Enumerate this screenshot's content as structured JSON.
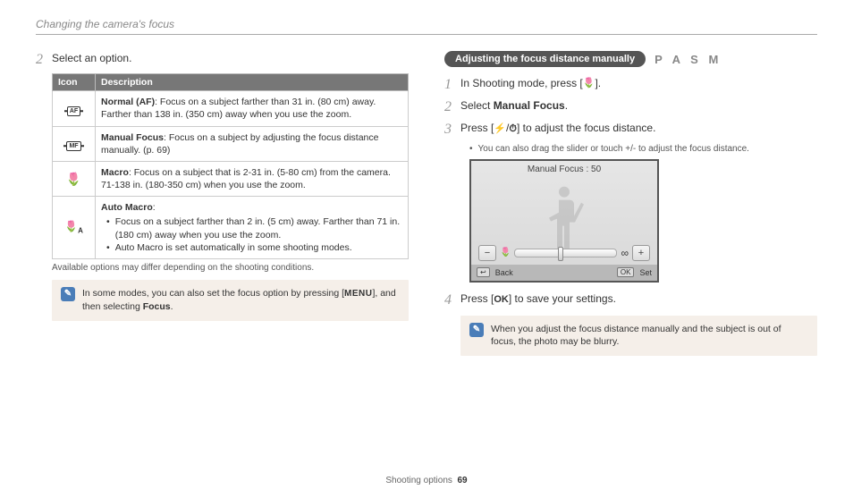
{
  "header": "Changing the camera's focus",
  "left": {
    "step2_num": "2",
    "step2_text": "Select an option.",
    "table": {
      "th_icon": "Icon",
      "th_desc": "Description",
      "rows": [
        {
          "icon_label": "AF",
          "icon_name": "normal-af-icon",
          "strong": "Normal (AF)",
          "rest": ": Focus on a subject farther than 31 in. (80 cm) away. Farther than 138 in. (350 cm) away when you use the zoom."
        },
        {
          "icon_label": "MF",
          "icon_name": "manual-focus-icon",
          "strong": "Manual Focus",
          "rest": ": Focus on a subject by adjusting the focus distance manually. (p. 69)"
        },
        {
          "icon_label": "🌷",
          "icon_name": "macro-icon",
          "strong": "Macro",
          "rest": ": Focus on a subject that is 2-31 in. (5-80 cm) from the camera. 71-138 in. (180-350 cm) when you use the zoom."
        },
        {
          "icon_label": "🌷A",
          "icon_name": "auto-macro-icon",
          "strong": "Auto Macro",
          "rest": ":",
          "bullets": [
            "Focus on a subject farther than 2 in. (5 cm) away. Farther than 71 in. (180 cm) away when you use the zoom.",
            "Auto Macro is set automatically in some shooting modes."
          ]
        }
      ]
    },
    "options_note": "Available options may differ depending on the shooting conditions.",
    "tip_pre": "In some modes, you can also set the focus option by pressing [",
    "tip_menu": "MENU",
    "tip_mid": "], and then selecting ",
    "tip_focus": "Focus",
    "tip_end": "."
  },
  "right": {
    "pill": "Adjusting the focus distance manually",
    "modes": "P A S M",
    "step1_num": "1",
    "step1_pre": "In Shooting mode, press [",
    "step1_icon": "🌷",
    "step1_post": "].",
    "step2_num": "2",
    "step2_pre": "Select ",
    "step2_bold": "Manual Focus",
    "step2_post": ".",
    "step3_num": "3",
    "step3_pre": "Press [",
    "step3_icon1": "⚡",
    "step3_sep": "/",
    "step3_icon2": "⏱",
    "step3_post": "] to adjust the focus distance.",
    "step3_sub": "You can also drag the slider or touch +/- to adjust the focus distance.",
    "screen": {
      "title": "Manual Focus : 50",
      "minus": "−",
      "macro": "🌷",
      "inf": "∞",
      "plus": "+",
      "back_key": "↩",
      "back": "Back",
      "ok_key": "OK",
      "set": "Set"
    },
    "step4_num": "4",
    "step4_pre": "Press [",
    "step4_ok": "OK",
    "step4_post": "] to save your settings.",
    "tip": "When you adjust the focus distance manually and the subject is out of focus, the photo may be blurry."
  },
  "footer": {
    "section": "Shooting options",
    "page": "69"
  }
}
